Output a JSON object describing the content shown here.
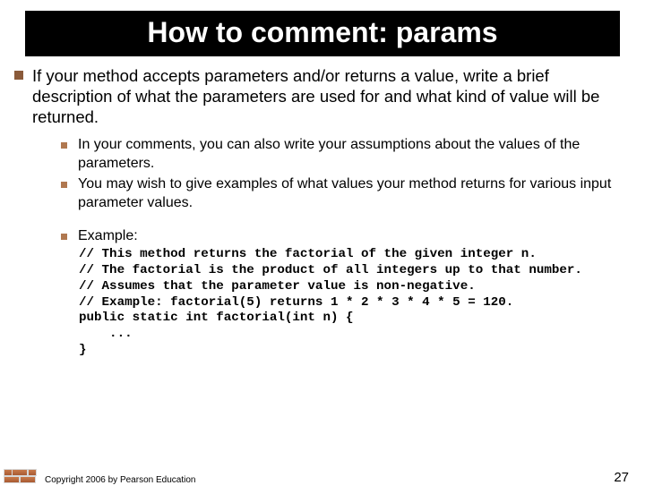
{
  "title": "How to comment: params",
  "main_bullet": "If your method accepts parameters and/or returns a value, write a brief description of what the parameters are used for and what kind of value will be returned.",
  "sub_bullets": [
    "In your comments, you can also write your assumptions about the values of the parameters.",
    "You may wish to give examples of what values your method returns for various input parameter values.",
    "Example:"
  ],
  "code": "// This method returns the factorial of the given integer n.\n// The factorial is the product of all integers up to that number.\n// Assumes that the parameter value is non-negative.\n// Example: factorial(5) returns 1 * 2 * 3 * 4 * 5 = 120.\npublic static int factorial(int n) {\n    ...\n}",
  "copyright": "Copyright 2006 by Pearson Education",
  "page": "27"
}
